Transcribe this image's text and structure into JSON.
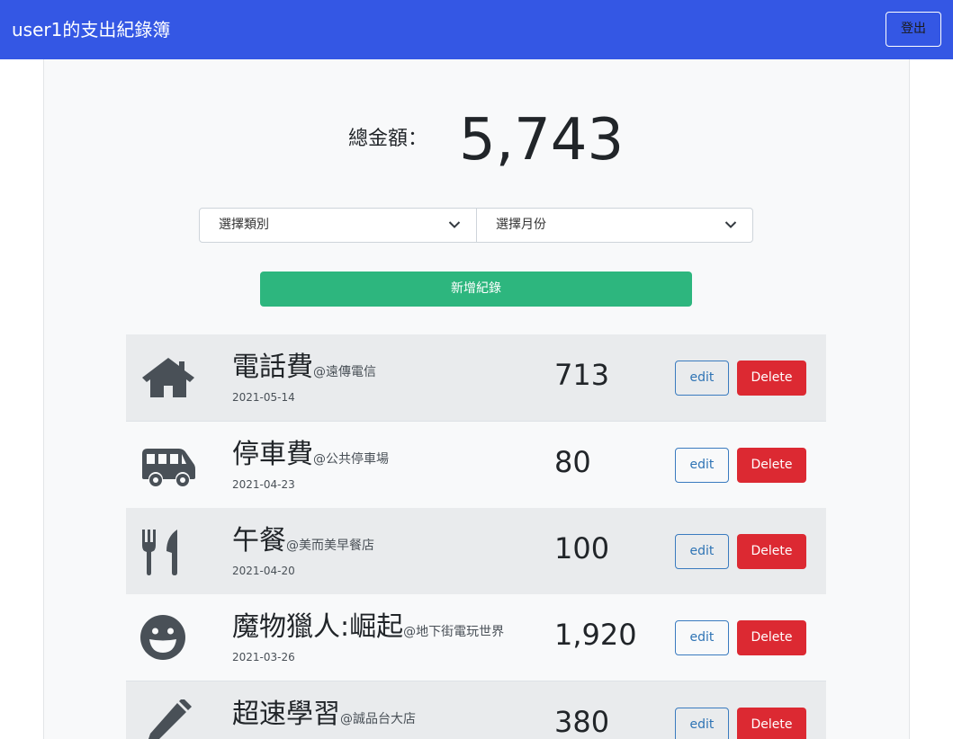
{
  "navbar": {
    "brand": "user1的支出紀錄簿",
    "logout_label": "登出"
  },
  "summary": {
    "total_label": "總金額：",
    "total_value": "5,743"
  },
  "filters": {
    "category_placeholder": "選擇類別",
    "month_placeholder": "選擇月份"
  },
  "actions": {
    "add_label": "新增紀錄"
  },
  "records": [
    {
      "icon": "home-icon",
      "name": "電話費",
      "merchant": "@遠傳電信",
      "date": "2021-05-14",
      "amount": "713",
      "edit_label": "edit",
      "delete_label": "Delete"
    },
    {
      "icon": "shuttle-van-icon",
      "name": "停車費",
      "merchant": "@公共停車場",
      "date": "2021-04-23",
      "amount": "80",
      "edit_label": "edit",
      "delete_label": "Delete"
    },
    {
      "icon": "utensils-icon",
      "name": "午餐",
      "merchant": "@美而美早餐店",
      "date": "2021-04-20",
      "amount": "100",
      "edit_label": "edit",
      "delete_label": "Delete"
    },
    {
      "icon": "grin-icon",
      "name": "魔物獵人:崛起",
      "merchant": "@地下街電玩世界",
      "date": "2021-03-26",
      "amount": "1,920",
      "edit_label": "edit",
      "delete_label": "Delete"
    },
    {
      "icon": "pen-icon",
      "name": "超速學習",
      "merchant": "@誠品台大店",
      "date": "",
      "amount": "380",
      "edit_label": "edit",
      "delete_label": "Delete"
    }
  ],
  "colors": {
    "navbar": "#3457e4",
    "add": "#2db67e",
    "delete": "#dc2932",
    "edit": "#2f74b5"
  }
}
